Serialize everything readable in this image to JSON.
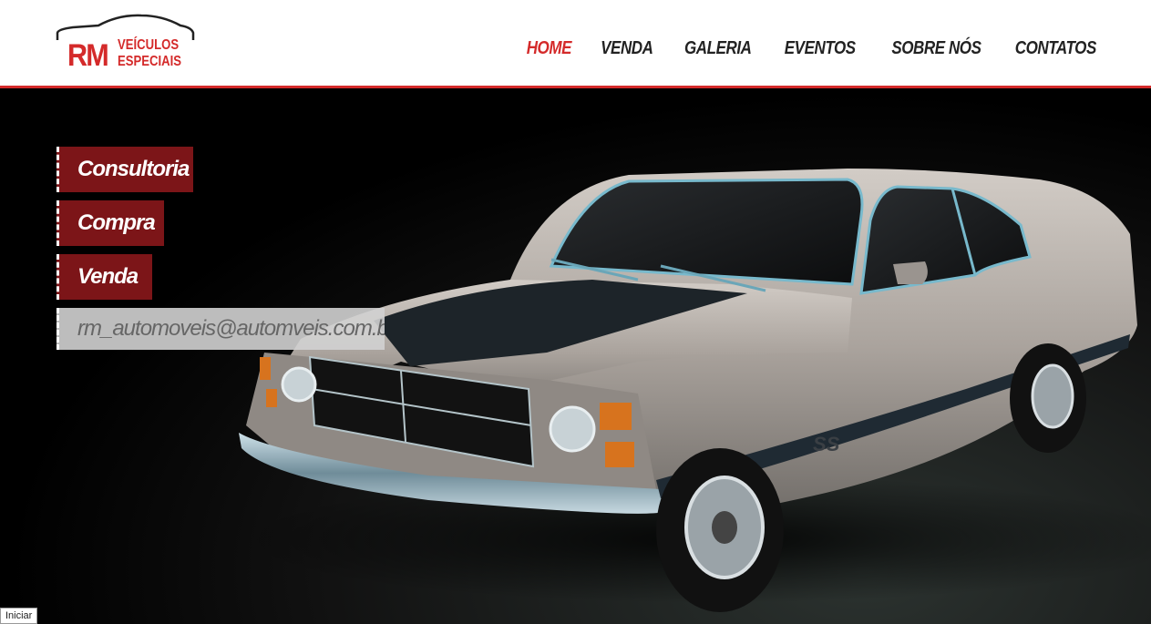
{
  "logo": {
    "rm": "RM",
    "line1": "VEÍCULOS",
    "line2": "ESPECIAIS"
  },
  "nav": [
    {
      "label": "HOME",
      "active": true
    },
    {
      "label": "VENDA",
      "active": false
    },
    {
      "label": "GALERIA",
      "active": false
    },
    {
      "label": "EVENTOS",
      "active": false
    },
    {
      "label": "SOBRE NÓS",
      "active": false
    },
    {
      "label": "CONTATOS",
      "active": false
    }
  ],
  "side_buttons": [
    {
      "label": "Consultoria"
    },
    {
      "label": "Compra"
    },
    {
      "label": "Venda"
    }
  ],
  "email": "rm_automoveis@automveis.com.br",
  "hero": {
    "car_badge": "SS"
  },
  "status": {
    "iniciar": "Iniciar"
  },
  "colors": {
    "accent": "#d42a2a",
    "button_bg": "#7c1518",
    "car_body": "#b3aca6",
    "car_stripe": "#1f2a33"
  }
}
